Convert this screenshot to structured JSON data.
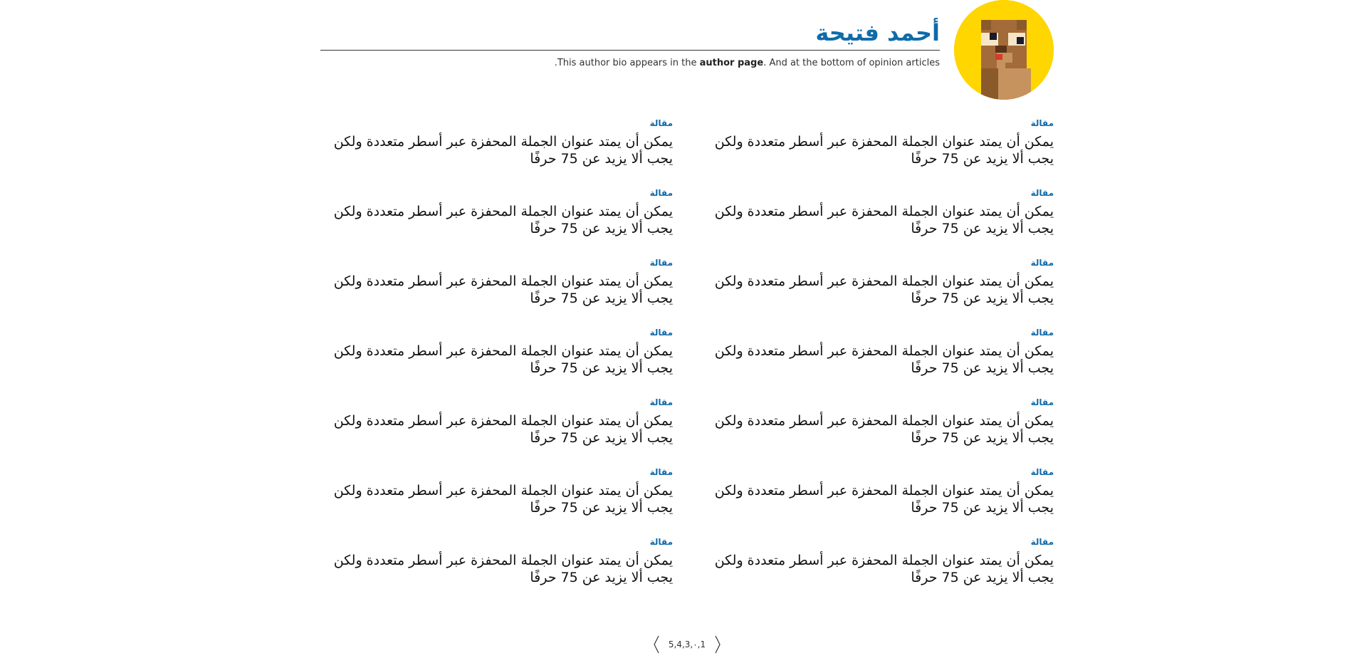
{
  "author": {
    "name": "أحمد فتيحة",
    "bio_part1": ".This author bio appears in the ",
    "bio_bold": "author page",
    "bio_part2": ". And at the bottom of opinion articles",
    "avatar_bg": "#FFD600"
  },
  "colors": {
    "accent": "#0F6BAA",
    "text": "#111111"
  },
  "articles": [
    {
      "category": "مقالة",
      "title": "يمكن أن يمتد عنوان الجملة المحفزة عبر أسطر متعددة ولكن يجب ألا يزيد عن 75 حرفًا"
    },
    {
      "category": "مقالة",
      "title": "يمكن أن يمتد عنوان الجملة المحفزة عبر أسطر متعددة ولكن يجب ألا يزيد عن 75 حرفًا"
    },
    {
      "category": "مقالة",
      "title": "يمكن أن يمتد عنوان الجملة المحفزة عبر أسطر متعددة ولكن يجب ألا يزيد عن 75 حرفًا"
    },
    {
      "category": "مقالة",
      "title": "يمكن أن يمتد عنوان الجملة المحفزة عبر أسطر متعددة ولكن يجب ألا يزيد عن 75 حرفًا"
    },
    {
      "category": "مقالة",
      "title": "يمكن أن يمتد عنوان الجملة المحفزة عبر أسطر متعددة ولكن يجب ألا يزيد عن 75 حرفًا"
    },
    {
      "category": "مقالة",
      "title": "يمكن أن يمتد عنوان الجملة المحفزة عبر أسطر متعددة ولكن يجب ألا يزيد عن 75 حرفًا"
    },
    {
      "category": "مقالة",
      "title": "يمكن أن يمتد عنوان الجملة المحفزة عبر أسطر متعددة ولكن يجب ألا يزيد عن 75 حرفًا"
    },
    {
      "category": "مقالة",
      "title": "يمكن أن يمتد عنوان الجملة المحفزة عبر أسطر متعددة ولكن يجب ألا يزيد عن 75 حرفًا"
    },
    {
      "category": "مقالة",
      "title": "يمكن أن يمتد عنوان الجملة المحفزة عبر أسطر متعددة ولكن يجب ألا يزيد عن 75 حرفًا"
    },
    {
      "category": "مقالة",
      "title": "يمكن أن يمتد عنوان الجملة المحفزة عبر أسطر متعددة ولكن يجب ألا يزيد عن 75 حرفًا"
    },
    {
      "category": "مقالة",
      "title": "يمكن أن يمتد عنوان الجملة المحفزة عبر أسطر متعددة ولكن يجب ألا يزيد عن 75 حرفًا"
    },
    {
      "category": "مقالة",
      "title": "يمكن أن يمتد عنوان الجملة المحفزة عبر أسطر متعددة ولكن يجب ألا يزيد عن 75 حرفًا"
    },
    {
      "category": "مقالة",
      "title": "يمكن أن يمتد عنوان الجملة المحفزة عبر أسطر متعددة ولكن يجب ألا يزيد عن 75 حرفًا"
    },
    {
      "category": "مقالة",
      "title": "يمكن أن يمتد عنوان الجملة المحفزة عبر أسطر متعددة ولكن يجب ألا يزيد عن 75 حرفًا"
    }
  ],
  "pagination": {
    "pages_text": "5,4,3,٠,1",
    "prev_icon": "chevron-left-icon",
    "next_icon": "chevron-right-icon"
  }
}
